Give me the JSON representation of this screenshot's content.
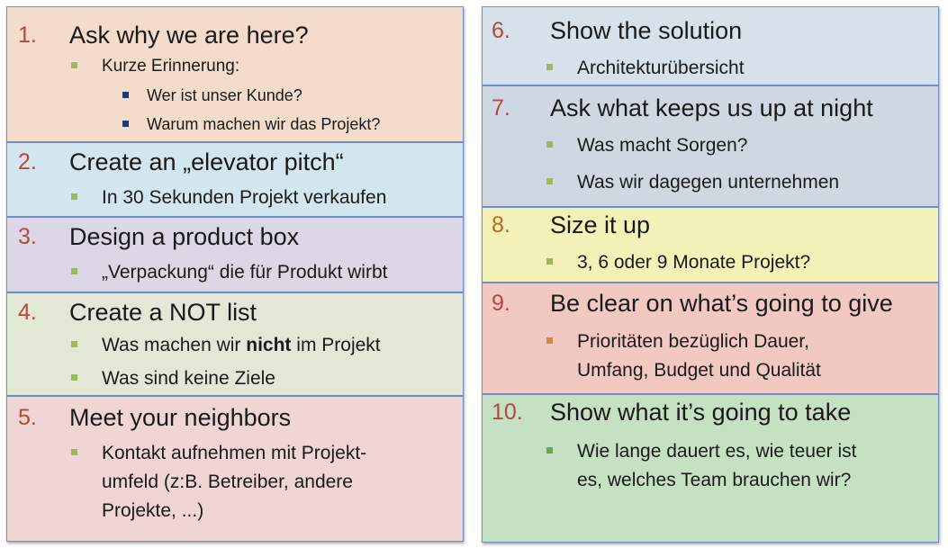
{
  "items": [
    {
      "num": "1.",
      "title": "Ask why we are here?",
      "color": "#f3dccb",
      "bullets": [
        "Kurze Erinnerung:"
      ],
      "sub": [
        "Wer ist unser Kunde?",
        "Warum machen wir das Projekt?"
      ]
    },
    {
      "num": "2.",
      "title": "Create an „elevator pitch“",
      "color": "#d3e5ee",
      "bullets": [
        "In 30 Sekunden Projekt verkaufen"
      ]
    },
    {
      "num": "3.",
      "title": "Design a product box",
      "color": "#dcd7e7",
      "bullets": [
        "„Verpackung“ die für Produkt wirbt"
      ]
    },
    {
      "num": "4.",
      "title": "Create a NOT list",
      "color": "#e2e8d6",
      "bullets_rich": {
        "pre": "Was machen wir ",
        "bold": "nicht",
        "post": " im Projekt"
      },
      "bullets": [
        "Was sind keine Ziele"
      ]
    },
    {
      "num": "5.",
      "title": "Meet your neighbors",
      "color": "#efd5d4",
      "bullets_lines": [
        "Kontakt aufnehmen mit Projekt-",
        "umfeld (z:B. Betreiber, andere",
        "Projekte, ...)"
      ]
    },
    {
      "num": "6.",
      "title": "Show the solution",
      "color": "#d7e1ec",
      "bullets": [
        "Architekturübersicht"
      ]
    },
    {
      "num": "7.",
      "title": "Ask what keeps us up at night",
      "color": "#cfd8e2",
      "bullets": [
        "Was macht Sorgen?",
        "Was wir dagegen unternehmen"
      ]
    },
    {
      "num": "8.",
      "title": "Size it up",
      "color": "#f4f1b8",
      "bullets": [
        "3, 6 oder 9 Monate Projekt?"
      ]
    },
    {
      "num": "9.",
      "title": "Be clear on what’s going to give",
      "color": "#f2c8c3",
      "bullets_lines": [
        "Prioritäten bezüglich Dauer,",
        "Umfang, Budget und Qualität"
      ]
    },
    {
      "num": "10.",
      "title": "Show what it’s going to take",
      "color": "#c6e0c3",
      "bullets_lines": [
        "Wie lange dauert es, wie teuer ist",
        "es, welches Team brauchen wir?"
      ]
    }
  ]
}
